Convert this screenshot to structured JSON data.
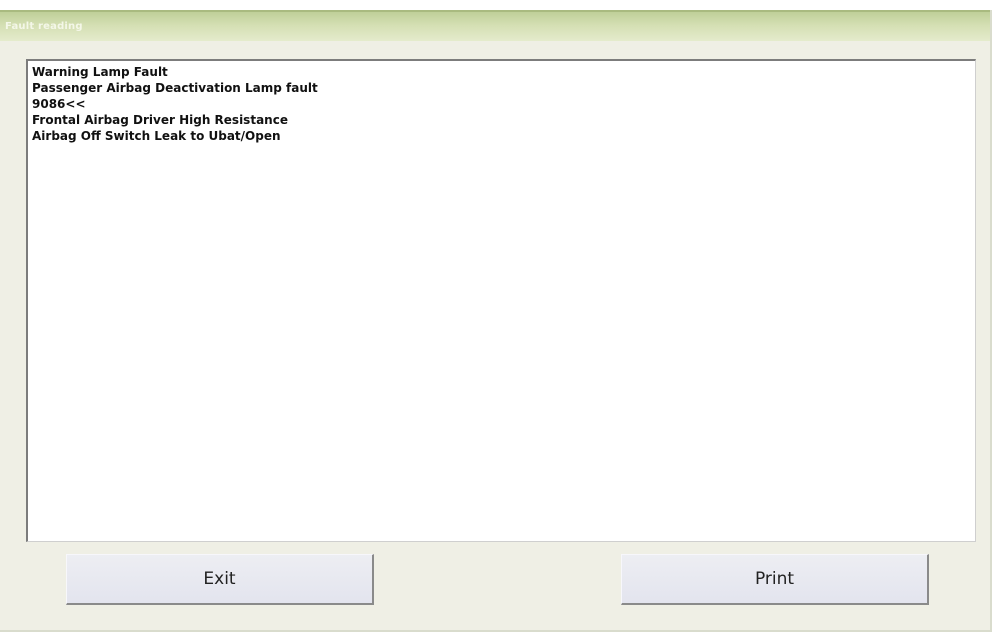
{
  "window": {
    "title": "Fault reading"
  },
  "faults": [
    "Warning Lamp Fault",
    "Passenger Airbag Deactivation Lamp fault",
    "9086<<",
    "Frontal Airbag Driver High Resistance",
    "Airbag Off Switch Leak to Ubat/Open"
  ],
  "buttons": {
    "exit_label": "Exit",
    "print_label": "Print"
  },
  "colors": {
    "titlebar": "#c9d6a6",
    "window_bg": "#efefe5",
    "button_bg": "#e8e9f0"
  }
}
